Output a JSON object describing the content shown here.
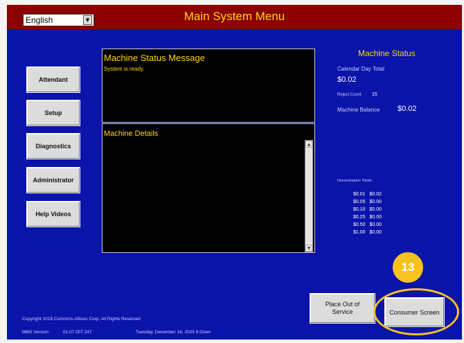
{
  "header": {
    "language": "English",
    "title": "Main System Menu"
  },
  "sidebar": {
    "buttons": [
      "Attendant",
      "Setup",
      "Diagnostics",
      "Administrator",
      "Help Videos"
    ]
  },
  "status_panel": {
    "heading": "Machine Status Message",
    "message": "System is ready."
  },
  "details_panel": {
    "heading": "Machine Details"
  },
  "machine_status": {
    "title": "Machine Status",
    "calendar_label": "Calendar Day Total",
    "calendar_value": "$0.02",
    "reject_label": "Reject Count",
    "reject_value": "15",
    "balance_label": "Machine Balance",
    "balance_value": "$0.02",
    "denom_label": "Denomination Totals",
    "denominations": [
      {
        "denom": "$0.01",
        "total": "$0.02"
      },
      {
        "denom": "$0.05",
        "total": "$0.00"
      },
      {
        "denom": "$0.10",
        "total": "$0.00"
      },
      {
        "denom": "$0.25",
        "total": "$0.00"
      },
      {
        "denom": "$0.50",
        "total": "$0.00"
      },
      {
        "denom": "$1.00",
        "total": "$0.00"
      }
    ]
  },
  "badge": "13",
  "actions": {
    "place_out_line1": "Place Out of",
    "place_out_line2": "Service",
    "consumer_screen": "Consumer Screen"
  },
  "footer": {
    "copyright": "Copyright 2018 Cummins-Allison Corp. All Rights Reserved",
    "version_label": "MM2 Version",
    "version": "01.07.007.247",
    "datetime": "Tuesday, December 16, 2025 9:32am"
  },
  "colors": {
    "background": "#0a14a8",
    "titlebar": "#8b0000",
    "accent": "#ffd700",
    "highlight": "#f6c21e"
  }
}
